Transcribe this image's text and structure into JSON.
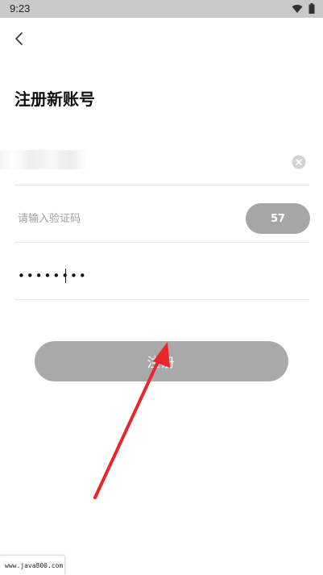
{
  "status_bar": {
    "time": "9:23"
  },
  "header": {
    "title": "注册新账号"
  },
  "form": {
    "phone": {
      "value": "，"
    },
    "code": {
      "placeholder": "请输入验证码",
      "countdown": "57"
    },
    "password": {
      "value": "••••••••"
    },
    "register_label": "注册"
  },
  "watermark": "www.java800.com",
  "colors": {
    "status_bar": "#c9c9c9",
    "button_disabled": "#a9a9a9",
    "arrow": "#e8262b"
  }
}
